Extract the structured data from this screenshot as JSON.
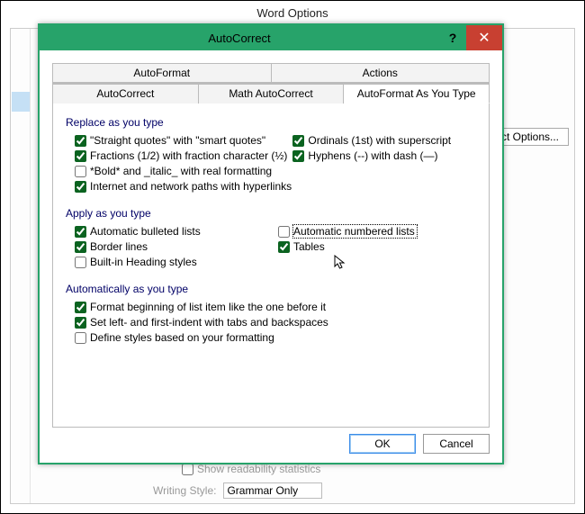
{
  "wordopts": {
    "title": "Word Options",
    "autocorrect_button": "AutoCorrect Options...",
    "readability_label": "Show readability statistics",
    "writing_style_label": "Writing Style:",
    "writing_style_value": "Grammar Only"
  },
  "dialog": {
    "title": "AutoCorrect",
    "help": "?",
    "close": "✕",
    "tabs_top": [
      "AutoFormat",
      "Actions"
    ],
    "tabs_bot": [
      "AutoCorrect",
      "Math AutoCorrect",
      "AutoFormat As You Type"
    ],
    "sections": {
      "replace": {
        "label": "Replace as you type",
        "opts": [
          {
            "label": "\"Straight quotes\" with \"smart quotes\"",
            "checked": true,
            "col": 1
          },
          {
            "label": "Ordinals (1st) with superscript",
            "checked": true,
            "col": 2
          },
          {
            "label": "Fractions (1/2) with fraction character (½)",
            "checked": true,
            "col": 1
          },
          {
            "label": "Hyphens (--) with dash (—)",
            "checked": true,
            "col": 2
          },
          {
            "label": "*Bold* and _italic_ with real formatting",
            "checked": false,
            "col": "wide"
          },
          {
            "label": "Internet and network paths with hyperlinks",
            "checked": true,
            "col": "wide"
          }
        ]
      },
      "apply": {
        "label": "Apply as you type",
        "opts": [
          {
            "label": "Automatic bulleted lists",
            "checked": true,
            "col": 1
          },
          {
            "label": "Automatic numbered lists",
            "checked": false,
            "col": 2,
            "focused": true
          },
          {
            "label": "Border lines",
            "checked": true,
            "col": 1
          },
          {
            "label": "Tables",
            "checked": true,
            "col": 2
          },
          {
            "label": "Built-in Heading styles",
            "checked": false,
            "col": "wide"
          }
        ]
      },
      "auto": {
        "label": "Automatically as you type",
        "opts": [
          {
            "label": "Format beginning of list item like the one before it",
            "checked": true,
            "col": "wide"
          },
          {
            "label": "Set left- and first-indent with tabs and backspaces",
            "checked": true,
            "col": "wide"
          },
          {
            "label": "Define styles based on your formatting",
            "checked": false,
            "col": "wide"
          }
        ]
      }
    },
    "buttons": {
      "ok": "OK",
      "cancel": "Cancel"
    }
  }
}
